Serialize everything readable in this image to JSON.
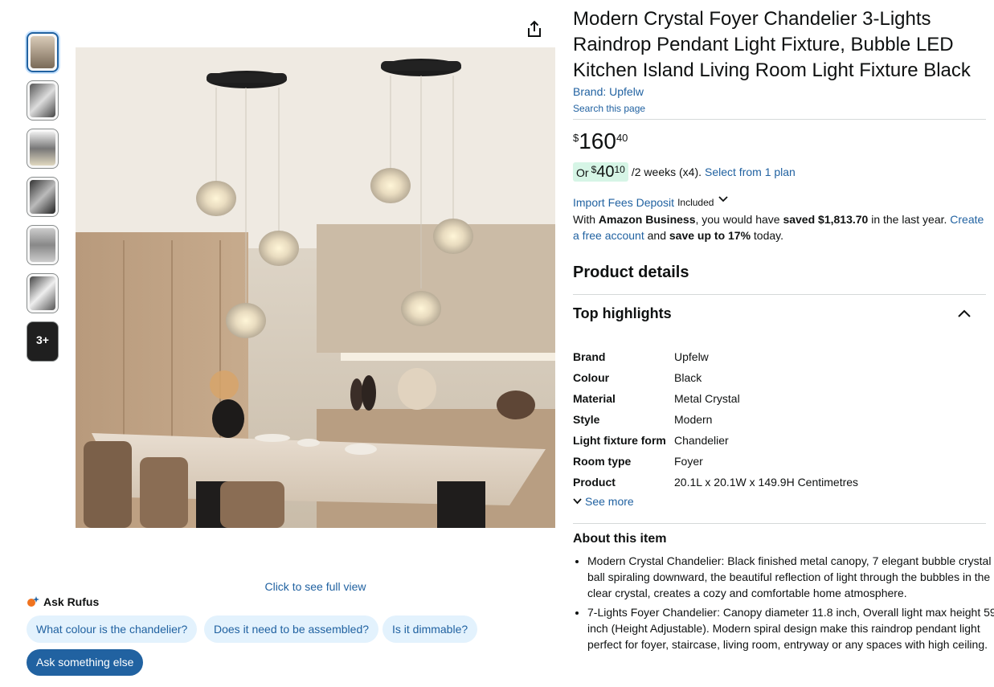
{
  "product": {
    "title": "Modern Crystal Foyer Chandelier 3-Lights Raindrop Pendant Light Fixture, Bubble LED Kitchen Island Living Room Light Fixture Black",
    "brand_link": "Brand: Upfelw",
    "search_page": "Search this page"
  },
  "price": {
    "symbol": "$",
    "whole": "160",
    "fraction": "40"
  },
  "installment": {
    "or": "Or",
    "symbol": "$",
    "whole": "40",
    "fraction": "10",
    "rest": "/2 weeks (x4).",
    "link": "Select from 1 plan"
  },
  "import_fees": {
    "link": "Import Fees Deposit",
    "included": "Included"
  },
  "business": {
    "p1": "With ",
    "bold1": "Amazon Business",
    "p2": ", you would have ",
    "bold2": "saved $1,813.70",
    "p3": " in the last year. ",
    "link": "Create a free account",
    "p4": " and ",
    "bold3": "save up to 17%",
    "p5": " today."
  },
  "product_details": {
    "heading": "Product details"
  },
  "top_highlights": {
    "heading": "Top highlights",
    "specs": [
      {
        "key": "Brand",
        "value": "Upfelw"
      },
      {
        "key": "Colour",
        "value": "Black"
      },
      {
        "key": "Material",
        "value": "Metal Crystal"
      },
      {
        "key": "Style",
        "value": "Modern"
      },
      {
        "key": "Light fixture form",
        "value": "Chandelier"
      },
      {
        "key": "Room type",
        "value": "Foyer"
      },
      {
        "key": "Product",
        "value": "20.1L x 20.1W x 149.9H Centimetres"
      }
    ],
    "see_more": "See more"
  },
  "about": {
    "heading": "About this item",
    "bullets": [
      "Modern Crystal Chandelier: Black finished metal canopy, 7 elegant bubble crystal ball spiraling downward, the beautiful reflection of light through the bubbles in the clear crystal, creates a cozy and comfortable home atmosphere.",
      "7-Lights Foyer Chandelier: Canopy diameter 11.8 inch, Overall light max height 59 inch (Height Adjustable). Modern spiral design make this raindrop pendant light perfect for foyer, staircase, living room, entryway or any spaces with high ceiling."
    ]
  },
  "gallery": {
    "full_view": "Click to see full view",
    "more_label": "3+"
  },
  "rufus": {
    "title": "Ask Rufus",
    "chips": [
      "What colour is the chandelier?",
      "Does it need to be assembled?",
      "Is it dimmable?"
    ],
    "ask_button": "Ask something else"
  },
  "colors": {
    "link": "#2162a1",
    "deal_bg": "#d6f5e6",
    "chip_bg": "#e3f2fd"
  }
}
